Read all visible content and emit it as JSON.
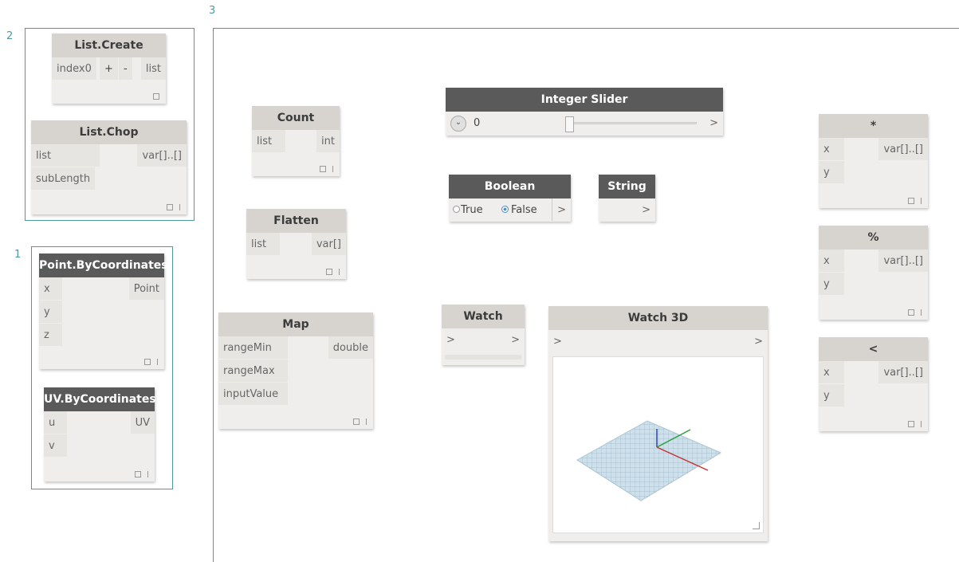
{
  "groups": {
    "g1": "1",
    "g2": "2",
    "g3": "3"
  },
  "nodes": {
    "list_create": {
      "title": "List.Create",
      "in0": "index0",
      "plus": "+",
      "minus": "-",
      "out": "list"
    },
    "list_chop": {
      "title": "List.Chop",
      "in0": "list",
      "in1": "subLength",
      "out": "var[]..[]"
    },
    "point_by_coords": {
      "title": "Point.ByCoordinates",
      "in0": "x",
      "in1": "y",
      "in2": "z",
      "out": "Point"
    },
    "uv_by_coords": {
      "title": "UV.ByCoordinates",
      "in0": "u",
      "in1": "v",
      "out": "UV"
    },
    "count": {
      "title": "Count",
      "in0": "list",
      "out": "int"
    },
    "flatten": {
      "title": "Flatten",
      "in0": "list",
      "out": "var[]"
    },
    "map": {
      "title": "Map",
      "in0": "rangeMin",
      "in1": "rangeMax",
      "in2": "inputValue",
      "out": "double"
    },
    "integer_slider": {
      "title": "Integer Slider",
      "value": "0",
      "out": ">",
      "slider_fraction": 0.0
    },
    "boolean": {
      "title": "Boolean",
      "opt_true": "True",
      "opt_false": "False",
      "selected": "False",
      "out": ">"
    },
    "string": {
      "title": "String",
      "out": ">"
    },
    "watch": {
      "title": "Watch",
      "in": ">",
      "out": ">"
    },
    "watch3d": {
      "title": "Watch 3D",
      "in": ">",
      "out": ">"
    },
    "multiply": {
      "title": "*",
      "in0": "x",
      "in1": "y",
      "out": "var[]..[]"
    },
    "modulo": {
      "title": "%",
      "in0": "x",
      "in1": "y",
      "out": "var[]..[]"
    },
    "less_than": {
      "title": "<",
      "in0": "x",
      "in1": "y",
      "out": "var[]..[]"
    }
  },
  "icons": {
    "node_footer": [
      "square-icon",
      "bar-icon"
    ],
    "slider_toggle": "chevron-down-icon",
    "resize": "resize-grip-icon"
  },
  "colors": {
    "group_border": "#4a9aa0",
    "dark_header": "#5a5a5a",
    "light_header": "#d7d4cf",
    "node_body": "#efeeec"
  }
}
